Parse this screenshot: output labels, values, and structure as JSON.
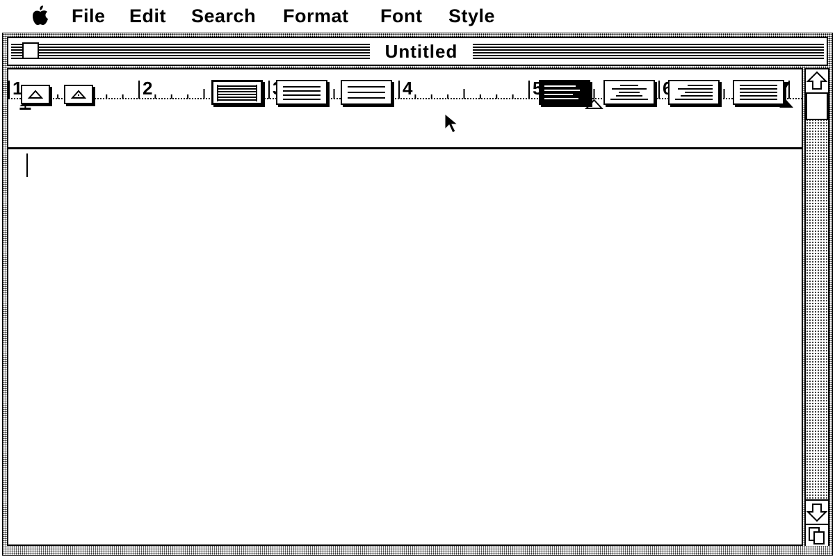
{
  "menubar": {
    "apple_icon": "apple-icon",
    "items": [
      "File",
      "Edit",
      "Search",
      "Format",
      "Font",
      "Style"
    ]
  },
  "window": {
    "title": "Untitled"
  },
  "ruler": {
    "labels": [
      "1",
      "2",
      "3",
      "4",
      "5",
      "6",
      "7"
    ],
    "left_margin": 1.125,
    "first_line_indent": 1.125,
    "paragraph_marker": 5.5,
    "right_margin": 7
  },
  "toolbar": {
    "tab_buttons": [
      "left-tab-icon",
      "decimal-tab-icon"
    ],
    "line_spacing": [
      "single",
      "one-and-half",
      "double"
    ],
    "alignment": [
      "left",
      "center",
      "right",
      "justify"
    ],
    "selected_line_spacing": "single",
    "selected_alignment": "left"
  },
  "document": {
    "text": ""
  }
}
